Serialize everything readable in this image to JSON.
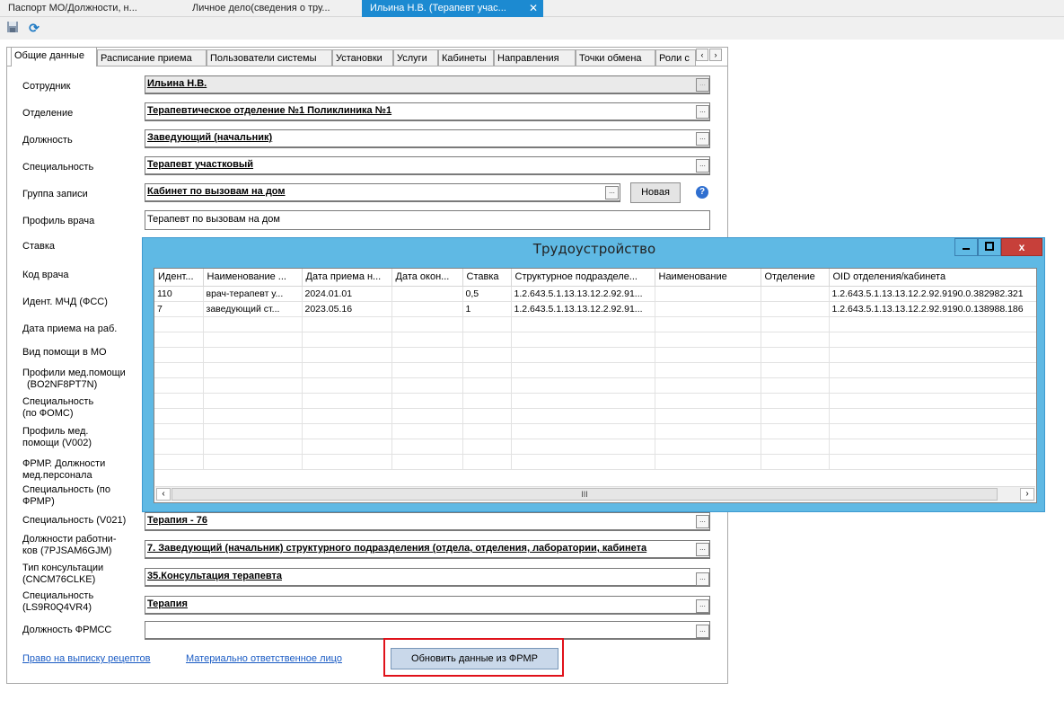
{
  "doc_tabs": [
    {
      "label": "Паспорт МО/Должности, н..."
    },
    {
      "label": "Личное дело(сведения о тру..."
    },
    {
      "label": "Ильина Н.В. (Терапевт учас..."
    }
  ],
  "toolbar": {
    "save_icon": "save-icon",
    "refresh_icon": "refresh-icon"
  },
  "form_tabs": [
    "Общие данные",
    "Расписание приема",
    "Пользователи системы",
    "Установки",
    "Услуги",
    "Кабинеты",
    "Направления",
    "Точки обмена",
    "Роли с"
  ],
  "fields": {
    "employee_label": "Сотрудник",
    "employee_value": "Ильина Н.В.",
    "department_label": "Отделение",
    "department_value": "Терапевтическое отделение №1 Поликлиника №1",
    "position_label": "Должность",
    "position_value": "Заведующий (начальник)",
    "specialty_label": "Специальность",
    "specialty_value": "Терапевт участковый",
    "group_label": "Группа записи",
    "group_value": "Кабинет по вызовам на дом",
    "group_new_button": "Новая",
    "profile_label": "Профиль врача",
    "profile_value": "Терапевт по вызовам на дом",
    "rate_label": "Ставка",
    "doctor_code_label": "Код врача",
    "mchd_label": "Идент. МЧД (ФСС)",
    "hire_date_label": "Дата приема на раб.",
    "care_type_label": "Вид помощи в МО",
    "med_profiles_label_1": "Профили мед.помощи",
    "med_profiles_label_2": "(BO2NF8PT7N)",
    "oms_specialty_label_1": "Специальность",
    "oms_specialty_label_2": "(по ФОМС)",
    "v002_label_1": "Профиль мед.",
    "v002_label_2": "помощи (V002)",
    "frmr_positions_label_1": "ФРМР. Должности",
    "frmr_positions_label_2": "мед.персонала",
    "frmr_specialty_label_1": "Специальность (по",
    "frmr_specialty_label_2": "ФРМР)",
    "v021_label": "Специальность (V021)",
    "v021_value": "Терапия - 76",
    "worker_pos_label_1": "Должности работни-",
    "worker_pos_label_2": "ков (7PJSAM6GJM)",
    "worker_pos_value": "7. Заведующий (начальник) структурного подразделения (отдела, отделения, лаборатории, кабинета",
    "consult_label_1": "Тип консультации",
    "consult_label_2": "(CNCM76CLKE)",
    "consult_value": "35.Консультация терапевта",
    "ls_specialty_label_1": "Специальность",
    "ls_specialty_label_2": "(LS9R0Q4VR4)",
    "ls_specialty_value": "Терапия",
    "frmss_label": "Должность ФРМСС",
    "frmss_value": ""
  },
  "footer": {
    "link_prescriptions": "Право на выписку рецептов",
    "link_responsible": "Материально ответственное лицо",
    "update_button": "Обновить данные из ФРМР"
  },
  "dialog": {
    "title": "Трудоустройство",
    "columns": [
      "Идент...",
      "Наименование ...",
      "Дата приема н...",
      "Дата окон...",
      "Ставка",
      "Структурное подразделе...",
      "Наименование",
      "Отделение",
      "OID отделения/кабинета"
    ],
    "rows": [
      [
        "110",
        "врач-терапевт у...",
        "2024.01.01",
        "",
        "0,5",
        "1.2.643.5.1.13.13.12.2.92.91...",
        "",
        "",
        "1.2.643.5.1.13.13.12.2.92.9190.0.382982.321"
      ],
      [
        "7",
        "заведующий ст...",
        "2023.05.16",
        "",
        "1",
        "1.2.643.5.1.13.13.12.2.92.91...",
        "",
        "",
        "1.2.643.5.1.13.13.12.2.92.9190.0.138988.186"
      ]
    ],
    "scroll_thumb": "III"
  }
}
